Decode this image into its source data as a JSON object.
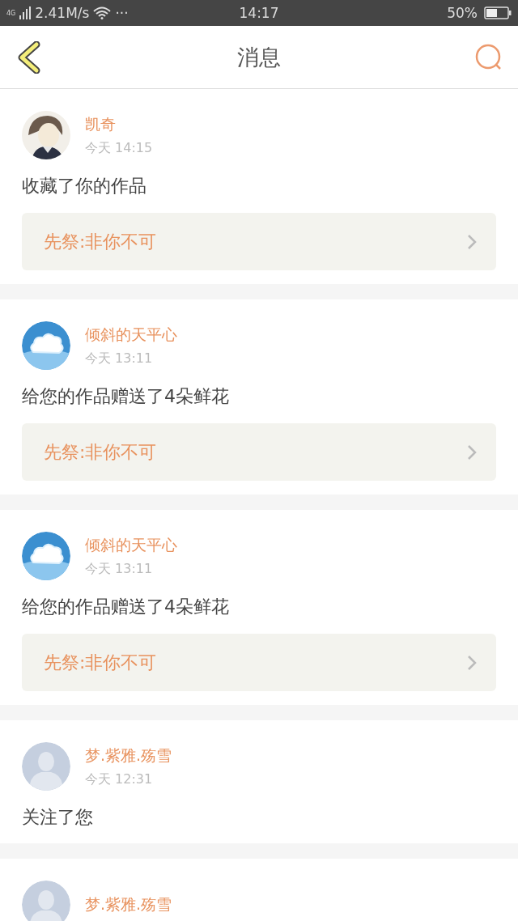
{
  "status_bar": {
    "network": "4G",
    "speed": "2.41M/s",
    "more": "···",
    "time": "14:17",
    "battery": "50%"
  },
  "header": {
    "title": "消息"
  },
  "messages": [
    {
      "name": "凯奇",
      "time": "今天 14:15",
      "text": "收藏了你的作品",
      "work": "先祭:非你不可"
    },
    {
      "avatar": {
        "kind": "cloud"
      },
      "name": "倾斜的天平心",
      "time": "今天 13:11",
      "text": "给您的作品赠送了4朵鲜花",
      "work": "先祭:非你不可"
    },
    {
      "avatar": {
        "kind": "cloud"
      },
      "name": "倾斜的天平心",
      "time": "今天 13:11",
      "text": "给您的作品赠送了4朵鲜花",
      "work": "先祭:非你不可"
    },
    {
      "avatar": {
        "kind": "default"
      },
      "name": "梦.紫雅.殇雪",
      "time": "今天 12:31",
      "text": "关注了您"
    },
    {
      "avatar": {
        "kind": "default"
      },
      "name": "梦.紫雅.殇雪"
    }
  ]
}
